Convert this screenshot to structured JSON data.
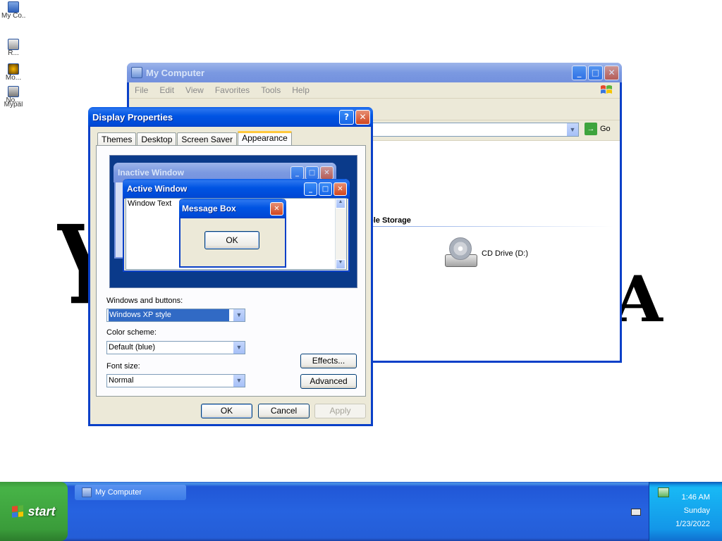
{
  "desktop": {
    "icons": [
      {
        "label": "My Co..."
      },
      {
        "label": "R..."
      },
      {
        "label": "Mo..."
      },
      {
        "label": "No..."
      },
      {
        "label": "Mypal"
      }
    ]
  },
  "my_computer": {
    "title": "My Computer",
    "menu": [
      "File",
      "Edit",
      "View",
      "Favorites",
      "Tools",
      "Help"
    ],
    "go_label": "Go",
    "section_partial": "ble Storage",
    "drive_partial_label": ":)",
    "cd_drive_label": "CD Drive (D:)"
  },
  "display_properties": {
    "title": "Display Properties",
    "help_glyph": "?",
    "close_glyph": "✕",
    "tabs": [
      "Themes",
      "Desktop",
      "Screen Saver",
      "Appearance"
    ],
    "active_tab": "Appearance",
    "preview": {
      "inactive_title": "Inactive Window",
      "active_title": "Active Window",
      "window_text": "Window Text",
      "message_title": "Message Box",
      "ok": "OK"
    },
    "windows_buttons_label": "Windows and buttons:",
    "windows_buttons_value": "Windows XP style",
    "color_scheme_label": "Color scheme:",
    "color_scheme_value": "Default (blue)",
    "font_size_label": "Font size:",
    "font_size_value": "Normal",
    "effects_button": "Effects...",
    "advanced_button": "Advanced",
    "ok_button": "OK",
    "cancel_button": "Cancel",
    "apply_button": "Apply"
  },
  "taskbar": {
    "start_label": "start",
    "task_button": "My Computer",
    "clock": {
      "time": "1:46 AM",
      "day": "Sunday",
      "date": "1/23/2022"
    }
  },
  "colors": {
    "xp_blue": "#0054e3",
    "start_green": "#3a9c3a",
    "dialog_face": "#ece9d8",
    "selection": "#316ac5"
  }
}
